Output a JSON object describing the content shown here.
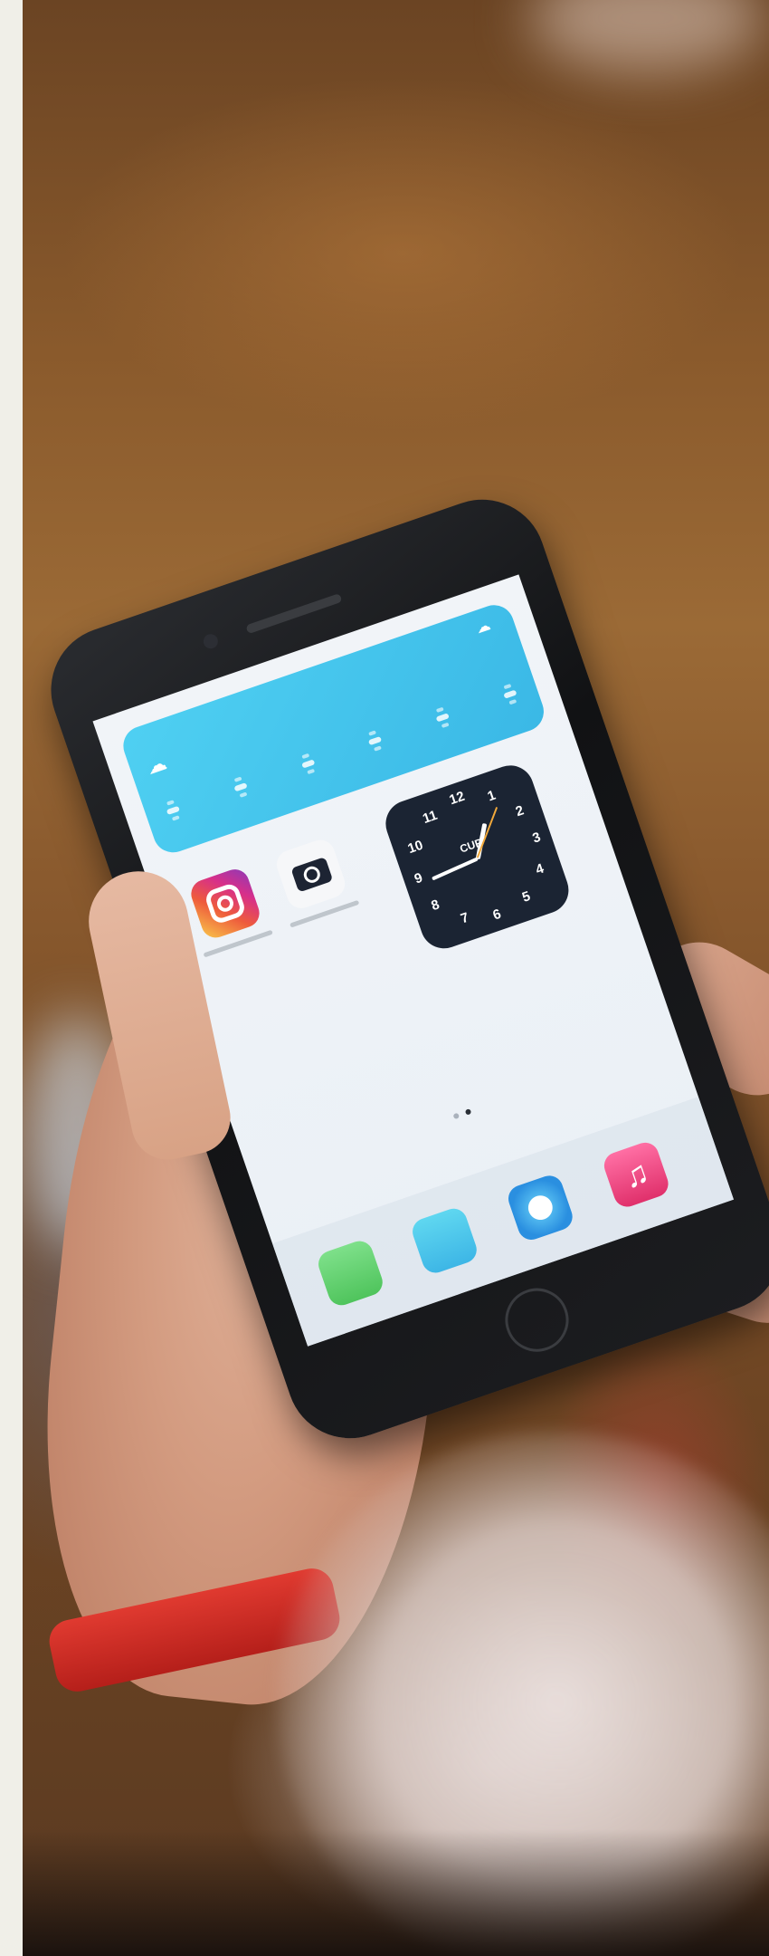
{
  "scene": {
    "description_colors": {
      "background": "#8a5a2c",
      "weather_widget": "#4fd0f2",
      "clock_widget": "#1b2433",
      "bracelet": "#e03a30"
    },
    "icons": [
      "instagram-icon",
      "camera-icon",
      "phone-icon",
      "mail-icon",
      "safari-icon",
      "music-icon"
    ]
  },
  "clock": {
    "label": "CUP",
    "numbers": [
      "12",
      "1",
      "2",
      "3",
      "4",
      "5",
      "6",
      "7",
      "8",
      "9",
      "10",
      "11"
    ]
  },
  "music_glyph": "♫"
}
